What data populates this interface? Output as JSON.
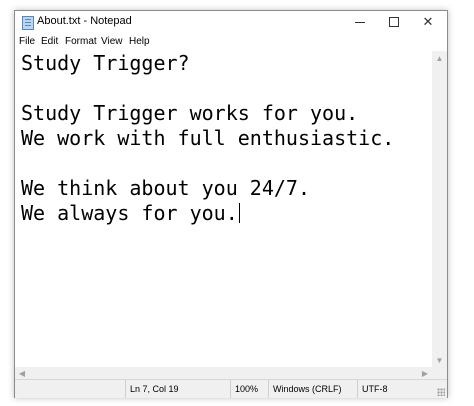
{
  "window": {
    "title": "About.txt - Notepad",
    "controls": {
      "minimize": "",
      "maximize": "",
      "close": "✕"
    }
  },
  "menu": {
    "items": [
      "File",
      "Edit",
      "Format",
      "View",
      "Help"
    ]
  },
  "editor": {
    "lines": [
      "Study Trigger?",
      "",
      "Study Trigger works for you.",
      "We work with full enthusiastic.",
      "",
      "We think about you 24/7.",
      "We always for you."
    ]
  },
  "status": {
    "position": "Ln 7, Col 19",
    "zoom": "100%",
    "line_ending": "Windows (CRLF)",
    "encoding": "UTF-8"
  },
  "icons": {
    "app": "notepad-icon",
    "scroll_up": "chevron-up-icon",
    "scroll_down": "chevron-down-icon",
    "scroll_left": "chevron-left-icon",
    "scroll_right": "chevron-right-icon"
  }
}
